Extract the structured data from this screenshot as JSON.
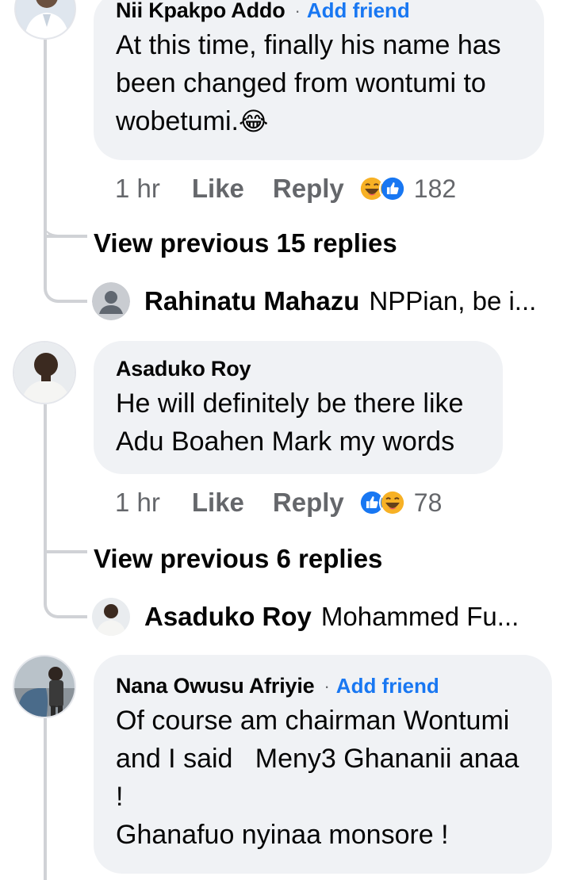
{
  "comments": [
    {
      "author": "Nii Kpakpo Addo",
      "separator": "·",
      "add_friend": "Add friend",
      "lines": [
        "At this time, finally his name has",
        "been changed from wontumi to",
        "wobetumi."
      ],
      "emoji": "😂",
      "time": "1 hr",
      "like_label": "Like",
      "reply_label": "Reply",
      "reaction_icons": [
        "haha-icon",
        "like-icon"
      ],
      "reaction_count": "182"
    },
    {
      "author": "Asaduko Roy",
      "lines": [
        "He will definitely be there like",
        "Adu Boahen Mark my words"
      ],
      "time": "1 hr",
      "like_label": "Like",
      "reply_label": "Reply",
      "reaction_icons": [
        "like-icon",
        "haha-icon"
      ],
      "reaction_count": "78"
    },
    {
      "author": "Nana Owusu Afriyie",
      "separator": "·",
      "add_friend": "Add friend",
      "lines": [
        "Of course am chairman Wontumi",
        "and I said   Meny3 Ghananii anaa",
        "!",
        "Ghanafuo nyinaa monsore !"
      ]
    }
  ],
  "thread1": {
    "view_previous": "View previous 15 replies",
    "reply_author": "Rahinatu Mahazu",
    "reply_preview": "NPPian, be i..."
  },
  "thread2": {
    "view_previous": "View previous 6 replies",
    "reply_author": "Asaduko Roy",
    "reply_preview": "Mohammed Fu..."
  },
  "colors": {
    "bubble": "#f0f2f5",
    "link_blue": "#1877f2",
    "muted": "#65676b",
    "thread_line": "#d0d2d6"
  }
}
